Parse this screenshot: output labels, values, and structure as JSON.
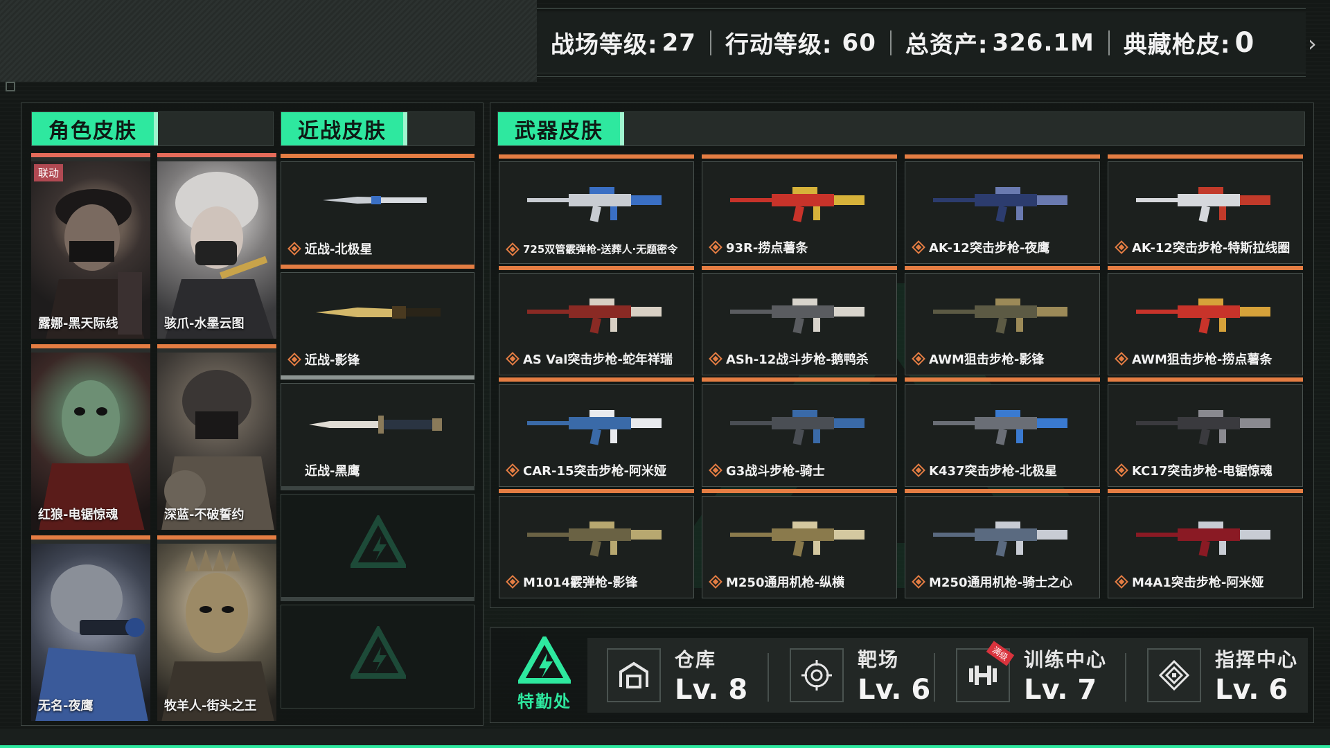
{
  "stats": {
    "battlefield_label": "战场等级:",
    "battlefield_value": "27",
    "operation_label": "行动等级:",
    "operation_value": "60",
    "assets_label": "总资产:",
    "assets_value": "326.1M",
    "collection_label": "典藏枪皮:",
    "collection_value": "0"
  },
  "tabs": {
    "character": "角色皮肤",
    "melee": "近战皮肤",
    "weapon": "武器皮肤"
  },
  "characters": [
    {
      "name": "露娜-黑天际线",
      "badge": "联动"
    },
    {
      "name": "骇爪-水墨云图"
    },
    {
      "name": "红狼-电锯惊魂"
    },
    {
      "name": "深蓝-不破誓约"
    },
    {
      "name": "无名-夜鹰"
    },
    {
      "name": "牧羊人-街头之王"
    }
  ],
  "melee": [
    {
      "name": "近战-北极星"
    },
    {
      "name": "近战-影锋"
    },
    {
      "name": "近战-黑鹰"
    }
  ],
  "weapons": [
    {
      "name": "725双管霰弹枪-送葬人·无题密令"
    },
    {
      "name": "93R-捞点薯条"
    },
    {
      "name": "AK-12突击步枪-夜鹰"
    },
    {
      "name": "AK-12突击步枪-特斯拉线圈"
    },
    {
      "name": "AS Val突击步枪-蛇年祥瑞"
    },
    {
      "name": "ASh-12战斗步枪-鹅鸭杀"
    },
    {
      "name": "AWM狙击步枪-影锋"
    },
    {
      "name": "AWM狙击步枪-捞点薯条"
    },
    {
      "name": "CAR-15突击步枪-阿米娅"
    },
    {
      "name": "G3战斗步枪-骑士"
    },
    {
      "name": "K437突击步枪-北极星"
    },
    {
      "name": "KC17突击步枪-电锯惊魂"
    },
    {
      "name": "M1014霰弹枪-影锋"
    },
    {
      "name": "M250通用机枪-纵横"
    },
    {
      "name": "M250通用机枪-骑士之心"
    },
    {
      "name": "M4A1突击步枪-阿米娅"
    }
  ],
  "hq": {
    "label": "特勤处"
  },
  "facilities": [
    {
      "name": "仓库",
      "level": "Lv. 8"
    },
    {
      "name": "靶场",
      "level": "Lv. 6"
    },
    {
      "name": "训练中心",
      "level": "Lv. 7",
      "badge": "满级"
    },
    {
      "name": "指挥中心",
      "level": "Lv. 6"
    }
  ],
  "colors": {
    "accent_green": "#2ee89f",
    "card_orange": "#e47d43",
    "card_red": "#e56b5a"
  }
}
